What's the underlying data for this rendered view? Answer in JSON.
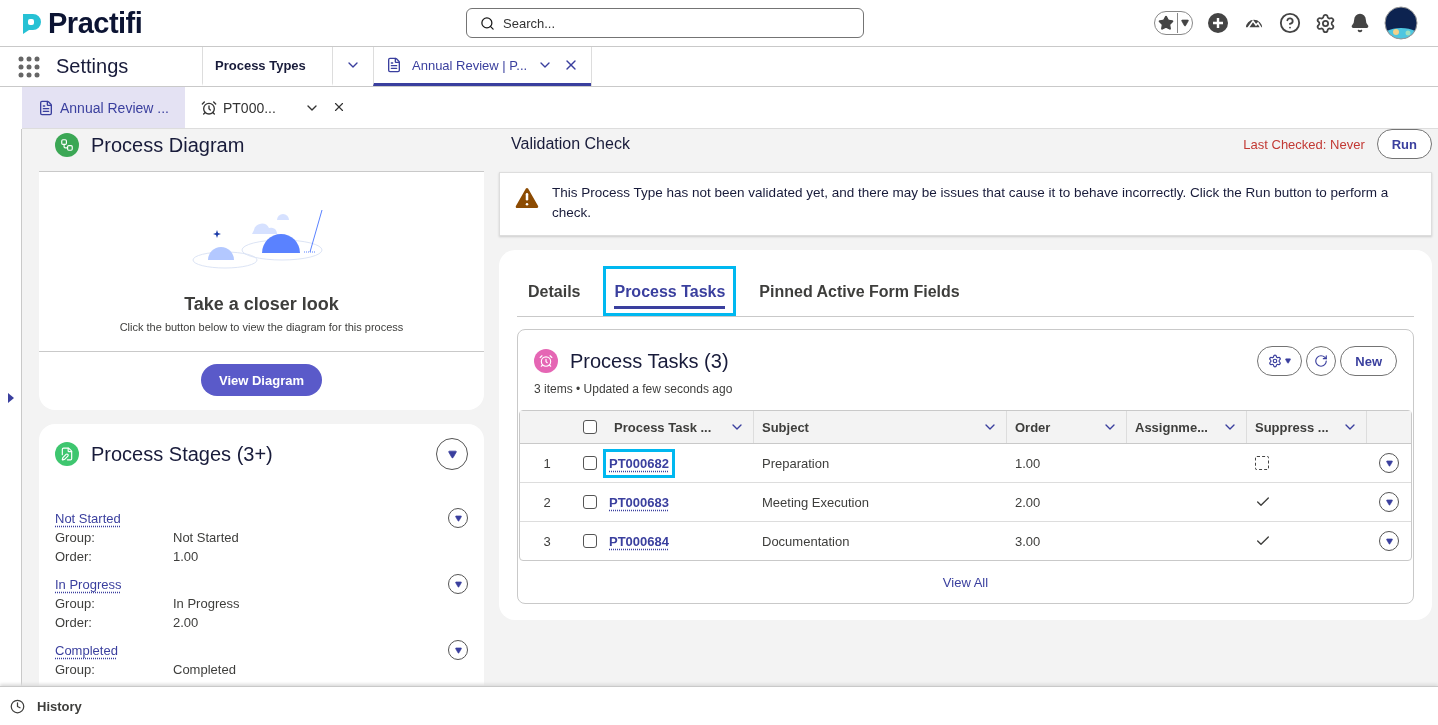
{
  "header": {
    "logo": "Practifi",
    "search": {
      "placeholder": "Search..."
    }
  },
  "nav": {
    "app_name": "Settings",
    "tabs": [
      {
        "label": "Process Types",
        "selected": false,
        "closable": false
      },
      {
        "label": "Annual Review | P...",
        "selected": true,
        "closable": true
      }
    ]
  },
  "subtabs": [
    {
      "label": "Annual Review ...",
      "selected": true,
      "kind": "record"
    },
    {
      "label": "PT000...",
      "selected": false,
      "kind": "task"
    }
  ],
  "diagram_card": {
    "title": "Process Diagram",
    "empty_title": "Take a closer look",
    "empty_text": "Click the button below to view the diagram for this process",
    "button": "View Diagram"
  },
  "stages_card": {
    "title": "Process Stages (3+)",
    "stages": [
      {
        "name": "Not Started",
        "fields": [
          {
            "label": "Group:",
            "value": "Not Started"
          },
          {
            "label": "Order:",
            "value": "1.00"
          }
        ]
      },
      {
        "name": "In Progress",
        "fields": [
          {
            "label": "Group:",
            "value": "In Progress"
          },
          {
            "label": "Order:",
            "value": "2.00"
          }
        ]
      },
      {
        "name": "Completed",
        "fields": [
          {
            "label": "Group:",
            "value": "Completed"
          }
        ]
      }
    ]
  },
  "validation": {
    "title": "Validation Check",
    "last_checked": "Last Checked: Never",
    "button": "Run",
    "message": "This Process Type has not been validated yet, and there may be issues that cause it to behave incorrectly. Click the Run button to perform a check."
  },
  "record_tabs": [
    {
      "label": "Details",
      "selected": false,
      "highlighted": false
    },
    {
      "label": "Process Tasks",
      "selected": true,
      "highlighted": true
    },
    {
      "label": "Pinned Active Form Fields",
      "selected": false,
      "highlighted": false
    }
  ],
  "related_list": {
    "title": "Process Tasks (3)",
    "meta": "3 items • Updated a few seconds ago",
    "new_button": "New",
    "select_all_checked": false,
    "columns": [
      "Process Task ...",
      "Subject",
      "Order",
      "Assignme...",
      "Suppress ..."
    ],
    "rows": [
      {
        "number": "1",
        "checked": false,
        "task": "PT000682",
        "highlighted": true,
        "subject": "Preparation",
        "order": "1.00",
        "suppress": false
      },
      {
        "number": "2",
        "checked": false,
        "task": "PT000683",
        "highlighted": false,
        "subject": "Meeting Execution",
        "order": "2.00",
        "suppress": true
      },
      {
        "number": "3",
        "checked": false,
        "task": "PT000684",
        "highlighted": false,
        "subject": "Documentation",
        "order": "3.00",
        "suppress": true
      }
    ],
    "view_all": "View All"
  },
  "footer": {
    "label": "History"
  }
}
